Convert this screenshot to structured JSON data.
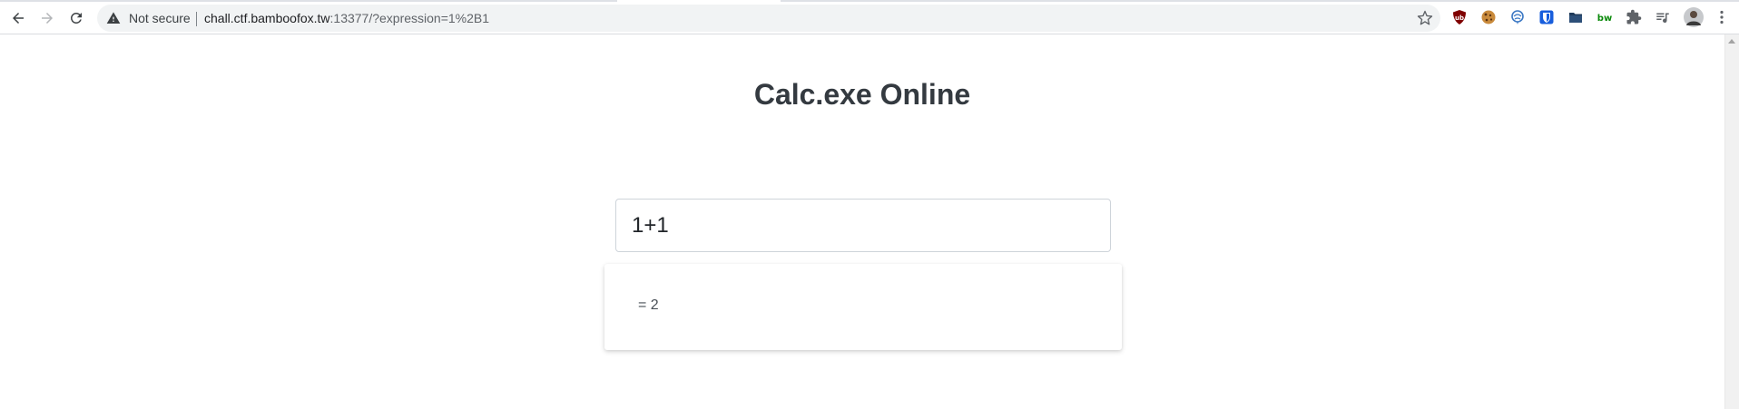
{
  "browser": {
    "security_label": "Not secure",
    "url_host": "chall.ctf.bamboofox.tw",
    "url_rest": ":13377/?expression=1%2B1",
    "icons": {
      "back": "back-arrow-icon",
      "forward": "forward-arrow-icon",
      "reload": "reload-icon",
      "warning": "warning-triangle-icon",
      "bookmark": "star-icon",
      "extensions": [
        "ublock-icon",
        "cookie-icon",
        "brain-icon",
        "bitwarden-icon",
        "folder-icon",
        "bw-icon",
        "puzzle-icon",
        "media-queue-icon",
        "profile-avatar",
        "kebab-menu-icon"
      ]
    },
    "colors": {
      "ublock": "#800000",
      "bitwarden": "#175ddc",
      "bw_text": "#0a8a0a"
    }
  },
  "page": {
    "title": "Calc.exe Online",
    "expression_value": "1+1",
    "result_text": "= 2"
  }
}
